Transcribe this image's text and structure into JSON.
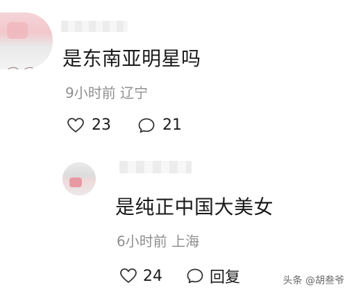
{
  "comment": {
    "text": "是东南亚明星吗",
    "time": "9小时前",
    "location": "辽宁",
    "likes": "23",
    "replies": "21"
  },
  "reply": {
    "text": "是纯正中国大美女",
    "time": "6小时前",
    "location": "上海",
    "likes": "24",
    "reply_label": "回复"
  },
  "watermark": "头条 @胡叁爷",
  "icons": [
    "heart-icon",
    "comment-bubble-icon",
    "reply-icon"
  ]
}
